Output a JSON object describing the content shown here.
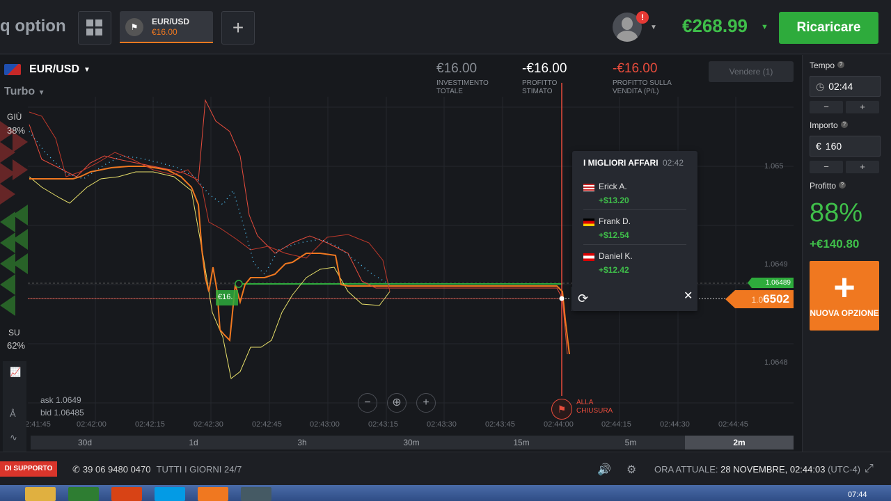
{
  "header": {
    "logo": "q option",
    "tab": {
      "asset": "EUR/USD",
      "amount": "€16.00"
    },
    "balance": "€268.99",
    "recharge_label": "Ricaricare",
    "notification": "!"
  },
  "chart": {
    "pair": "EUR/USD",
    "mode": "Turbo",
    "down_label": "GIÙ",
    "down_pct": "38%",
    "up_label": "SU",
    "up_pct": "62%",
    "stats": [
      {
        "value": "€16.00",
        "label": "INVESTIMENTO TOTALE",
        "color": "#8a8f96"
      },
      {
        "value": "-€16.00",
        "label": "PROFITTO STIMATO",
        "color": "#ffffff"
      },
      {
        "value": "-€16.00",
        "label": "PROFITTO SULLA VENDITA (P/L)",
        "color": "#e74c3c"
      }
    ],
    "sell_button": "Vendere (1)",
    "price_current_dim": "1.0",
    "price_current": "6502",
    "price_green": "1.06489",
    "axis_prices": [
      "1.065",
      "1.0649",
      "1.0648"
    ],
    "ask": "ask 1.0649",
    "bid": "bid 1.06485",
    "trade_marker": "€16.",
    "expiry_label_1": "ALLA",
    "expiry_label_2": "CHIUSURA",
    "time_labels": [
      "02:41:45",
      "02:42:00",
      "02:42:15",
      "02:42:30",
      "02:42:45",
      "02:43:00",
      "02:43:15",
      "02:43:30",
      "02:43:45",
      "02:44:00",
      "02:44:15",
      "02:44:30",
      "02:44:45"
    ],
    "periods": [
      "30d",
      "1d",
      "3h",
      "30m",
      "15m",
      "5m",
      "2m"
    ],
    "active_period": "2m"
  },
  "best_deals": {
    "title": "I MIGLIORI AFFARI",
    "time": "02:42",
    "rows": [
      {
        "name": "Erick A.",
        "amount": "+$13.20",
        "flag": "us"
      },
      {
        "name": "Frank D.",
        "amount": "+$12.54",
        "flag": "de"
      },
      {
        "name": "Daniel K.",
        "amount": "+$12.42",
        "flag": "at"
      }
    ]
  },
  "right_panel": {
    "time_label": "Tempo",
    "time_value": "02:44",
    "amount_label": "Importo",
    "currency": "€",
    "amount_value": "160",
    "profit_label": "Profitto",
    "profit_pct": "88%",
    "profit_amount": "+€140.80",
    "new_option_label": "NUOVA OPZIONE",
    "minus": "−",
    "plus": "+"
  },
  "footer": {
    "support": "DI SUPPORTO",
    "phone": "39 06 9480 0470",
    "hours": "TUTTI I GIORNI 24/7",
    "time_label": "ORA ATTUALE:",
    "time_value": "28 NOVEMBRE, 02:44:03",
    "tz": "(UTC-4)"
  },
  "taskbar": {
    "clock": "07:44"
  },
  "colors": {
    "accent": "#f07820",
    "positive": "#3fbf4a",
    "negative": "#e74c3c",
    "background": "#17191d"
  }
}
